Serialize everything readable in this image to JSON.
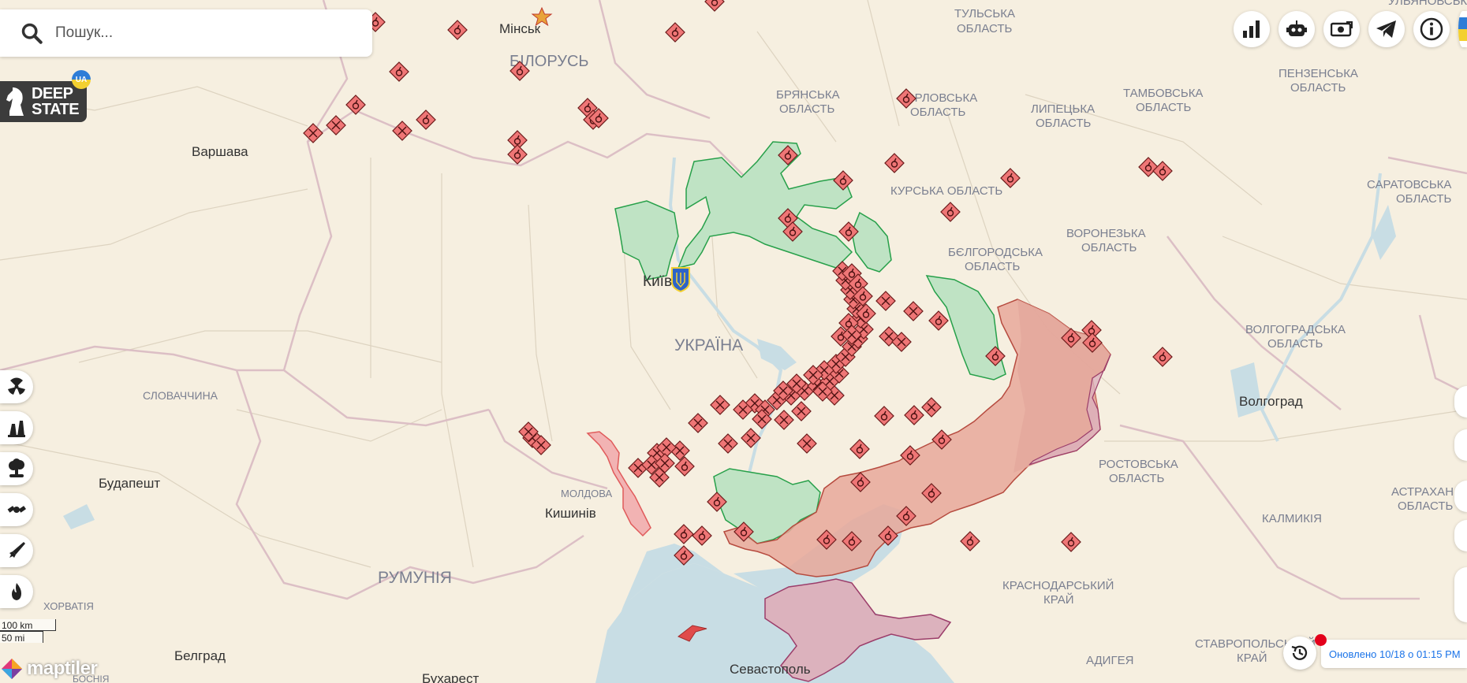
{
  "search": {
    "placeholder": "Пошук..."
  },
  "logo": {
    "line1": "DEEP",
    "line2": "STATE",
    "badge": "UA"
  },
  "labels": {
    "minsk": "Мінськ",
    "belarus": "БІЛОРУСЬ",
    "warsaw": "Варшава",
    "kyiv": "Київ",
    "ukraine": "УКРАЇНА",
    "slovakia": "СЛОВАЧЧИНА",
    "budapest": "Будапешт",
    "moldova": "МОЛДОВА",
    "chisinau": "Кишинів",
    "romania": "РУМУНІЯ",
    "croatia": "ХОРВАТІЯ",
    "belgrade": "Белград",
    "bucharest": "Бухарест",
    "bosnia": "БОСНІЯ",
    "sevastopol": "Севастополь",
    "tula": [
      "ТУЛЬСЬКА",
      "ОБЛАСТЬ"
    ],
    "bryansk": [
      "БРЯНСЬКА",
      "ОБЛАСТЬ"
    ],
    "oryol": [
      "ОРЛОВСЬКА",
      "ОБЛАСТЬ"
    ],
    "lipetsk": [
      "ЛИПЕЦЬКА",
      "ОБЛАСТЬ"
    ],
    "tambov": [
      "ТАМБОВСЬКА",
      "ОБЛАСТЬ"
    ],
    "penza": [
      "ПЕНЗЕНСЬКА",
      "ОБЛАСТЬ"
    ],
    "ulyanovsk": "УЛЬЯНОВСЬКА",
    "saratov": [
      "САРАТОВСЬКА",
      "ОБЛАСТЬ"
    ],
    "kursk": "КУРСЬКА ОБЛАСТЬ",
    "voronezh": [
      "ВОРОНЕЗЬКА",
      "ОБЛАСТЬ"
    ],
    "belgorod": [
      "БЄЛГОРОДСЬКА",
      "ОБЛАСТЬ"
    ],
    "volgograd": [
      "ВОЛГОГРАДСЬКА",
      "ОБЛАСТЬ"
    ],
    "volgograd_city": "Волгоград",
    "rostov": [
      "РОСТОВСЬКА",
      "ОБЛАСТЬ"
    ],
    "astrakhan": [
      "АСТРАХАН",
      "ОБЛАСТЬ"
    ],
    "kalmykia": "КАЛМИКІЯ",
    "krasnodar": [
      "КРАСНОДАРСЬКИЙ",
      "КРАЙ"
    ],
    "adygea": "АДИГЕЯ",
    "stavropol": [
      "СТАВРОПОЛЬСЬКИЙ",
      "КРАЙ"
    ]
  },
  "scale": {
    "km": "100 km",
    "mi": "50 mi"
  },
  "attribution": "maptiler",
  "updated": "Оновлено 10/18 о 01:15 PM",
  "toolbar_icons": [
    "stats-icon",
    "robot-icon",
    "donate-icon",
    "telegram-icon",
    "info-icon"
  ],
  "layer_icons": [
    "radiation-icon",
    "power-plant-icon",
    "explosion-icon",
    "satellite-icon",
    "missile-icon",
    "fire-icon"
  ],
  "colors": {
    "land": "#f6efe0",
    "sea": "#c8dde4",
    "occupied": "#e7a89a",
    "crimea": "#dcb2bd",
    "liberated": "#bfe3c4",
    "liberated_stroke": "#27a04a",
    "marker": "#ef7676",
    "transnistria": "#f2b3b3"
  },
  "strike_markers": [
    [
      476,
      28,
      "b"
    ],
    [
      580,
      38,
      "b"
    ],
    [
      506,
      91,
      "b"
    ],
    [
      451,
      133,
      "b"
    ],
    [
      540,
      152,
      "b"
    ],
    [
      397,
      169,
      "x"
    ],
    [
      426,
      159,
      "x"
    ],
    [
      510,
      166,
      "x"
    ],
    [
      659,
      90,
      "b"
    ],
    [
      656,
      178,
      "b"
    ],
    [
      656,
      196,
      "b"
    ],
    [
      745,
      137,
      "b"
    ],
    [
      752,
      152,
      "b"
    ],
    [
      759,
      150,
      "b"
    ],
    [
      856,
      41,
      "b"
    ],
    [
      906,
      2,
      "b"
    ],
    [
      999,
      197,
      "b"
    ],
    [
      1069,
      229,
      "b"
    ],
    [
      1134,
      207,
      "b"
    ],
    [
      1149,
      125,
      "b"
    ],
    [
      1281,
      226,
      "b"
    ],
    [
      1205,
      269,
      "b"
    ],
    [
      999,
      277,
      "b"
    ],
    [
      1005,
      294,
      "b"
    ],
    [
      1076,
      294,
      "b"
    ],
    [
      1456,
      212,
      "b"
    ],
    [
      1474,
      217,
      "b"
    ],
    [
      1190,
      407,
      "b"
    ],
    [
      1262,
      452,
      "b"
    ],
    [
      1358,
      429,
      "b"
    ],
    [
      1384,
      419,
      "b"
    ],
    [
      1385,
      435,
      "b"
    ],
    [
      1474,
      453,
      "b"
    ],
    [
      1123,
      382,
      "x"
    ],
    [
      1158,
      395,
      "x"
    ],
    [
      1127,
      427,
      "x"
    ],
    [
      1143,
      434,
      "x"
    ],
    [
      1121,
      528,
      "b"
    ],
    [
      1159,
      527,
      "b"
    ],
    [
      1181,
      517,
      "x"
    ],
    [
      1194,
      558,
      "b"
    ],
    [
      1090,
      570,
      "b"
    ],
    [
      1154,
      578,
      "b"
    ],
    [
      1091,
      612,
      "b"
    ],
    [
      1181,
      626,
      "b"
    ],
    [
      1149,
      655,
      "b"
    ],
    [
      1126,
      680,
      "b"
    ],
    [
      1080,
      687,
      "b"
    ],
    [
      1048,
      685,
      "b"
    ],
    [
      1230,
      687,
      "b"
    ],
    [
      1358,
      688,
      "b"
    ],
    [
      909,
      637,
      "b"
    ],
    [
      943,
      675,
      "b"
    ],
    [
      867,
      678,
      "b"
    ],
    [
      890,
      680,
      "b"
    ],
    [
      867,
      705,
      "b"
    ],
    [
      868,
      592,
      "b"
    ],
    [
      885,
      537,
      "x"
    ],
    [
      923,
      563,
      "x"
    ],
    [
      952,
      556,
      "x"
    ],
    [
      913,
      514,
      "x"
    ],
    [
      994,
      533,
      "x"
    ],
    [
      1016,
      522,
      "x"
    ],
    [
      1023,
      563,
      "x"
    ],
    [
      809,
      594,
      "x"
    ],
    [
      836,
      606,
      "x"
    ],
    [
      833,
      575,
      "x"
    ],
    [
      862,
      572,
      "x"
    ],
    [
      845,
      568,
      "x"
    ],
    [
      826,
      590,
      "x"
    ],
    [
      843,
      588,
      "x"
    ],
    [
      675,
      556,
      "x"
    ],
    [
      686,
      565,
      "x"
    ],
    [
      670,
      548,
      "x"
    ],
    [
      957,
      512,
      "x"
    ],
    [
      970,
      520,
      "x"
    ],
    [
      985,
      508,
      "x"
    ],
    [
      1003,
      502,
      "x"
    ],
    [
      1020,
      496,
      "x"
    ],
    [
      1036,
      490,
      "x"
    ],
    [
      1052,
      484,
      "x"
    ],
    [
      1064,
      474,
      "x"
    ],
    [
      1060,
      462,
      "x"
    ],
    [
      1072,
      453,
      "x"
    ],
    [
      1080,
      440,
      "x"
    ],
    [
      1088,
      430,
      "x"
    ],
    [
      1095,
      418,
      "x"
    ],
    [
      1091,
      404,
      "x"
    ],
    [
      1086,
      392,
      "x"
    ],
    [
      1082,
      380,
      "x"
    ],
    [
      1078,
      368,
      "x"
    ],
    [
      1072,
      356,
      "x"
    ],
    [
      1068,
      344,
      "x"
    ],
    [
      1080,
      347,
      "b"
    ],
    [
      1088,
      360,
      "b"
    ],
    [
      1094,
      376,
      "b"
    ],
    [
      1098,
      398,
      "b"
    ],
    [
      1076,
      410,
      "b"
    ],
    [
      1066,
      427,
      "b"
    ],
    [
      1045,
      470,
      "x"
    ],
    [
      1031,
      476,
      "x"
    ],
    [
      1010,
      487,
      "x"
    ],
    [
      993,
      496,
      "x"
    ],
    [
      1058,
      502,
      "x"
    ],
    [
      942,
      520,
      "x"
    ],
    [
      966,
      532,
      "x"
    ],
    [
      1043,
      497,
      "x"
    ],
    [
      1080,
      425,
      "x"
    ]
  ]
}
